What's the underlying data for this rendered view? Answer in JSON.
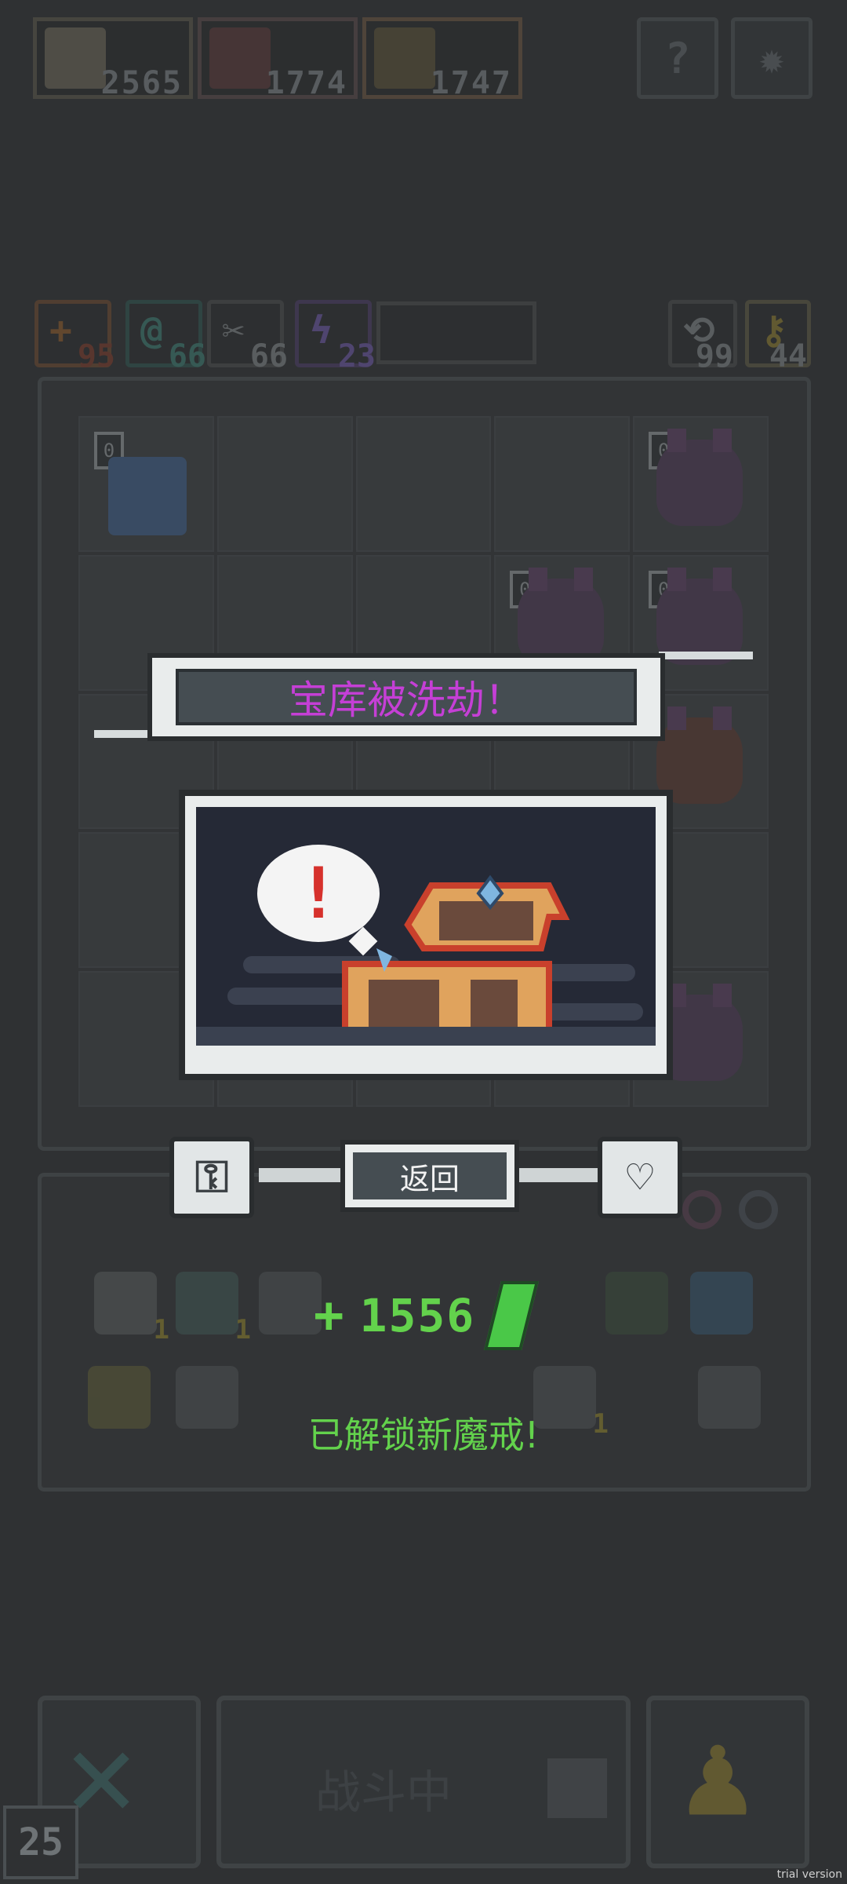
{
  "resources": [
    {
      "value": "2565",
      "icon": "hero-portrait",
      "color": "#5e5a44"
    },
    {
      "value": "1774",
      "icon": "demon-portrait",
      "color": "#5f4545"
    },
    {
      "value": "1747",
      "icon": "magic-wand",
      "color": "#5e5a44"
    }
  ],
  "top_buttons": {
    "help_label": "?",
    "settings_icon": "gear-icon"
  },
  "stats": [
    {
      "symbol": "+",
      "value": "95",
      "color": "#6c4a31"
    },
    {
      "symbol": "@",
      "value": "66",
      "color": "#2f5550"
    },
    {
      "symbol": "✂",
      "value": "66",
      "color": "#5a5e60"
    },
    {
      "symbol": "ϟ",
      "value": "23",
      "color": "#4c3d65"
    }
  ],
  "counters": [
    {
      "icon": "refresh-icon",
      "value": "99"
    },
    {
      "icon": "key-icon",
      "value": "44"
    }
  ],
  "grid_tags": [
    "0",
    "0",
    "0",
    "0"
  ],
  "modal": {
    "title": "宝库被洗劫！",
    "exclaim": "!",
    "back_label": "返回"
  },
  "reward": {
    "plus": "+",
    "amount": "1556",
    "message": "已解锁新魔戒!"
  },
  "inventory_quantities": [
    "1",
    "1",
    "1"
  ],
  "footer": {
    "battle_label": "战斗中",
    "level": "25"
  },
  "watermark": "trial version",
  "colors": {
    "title_magenta": "#c53fd6",
    "reward_green": "#63d24c",
    "panel_border": "#e9ecec"
  }
}
